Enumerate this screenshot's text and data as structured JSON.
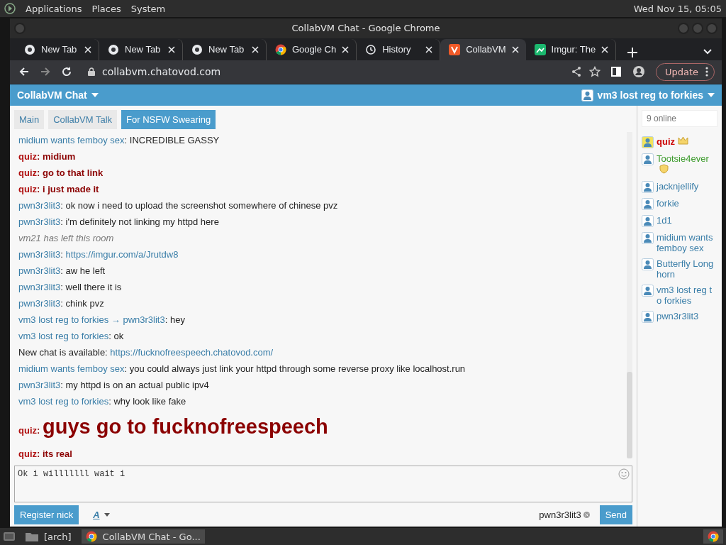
{
  "desktop_panel": {
    "menus": [
      "Applications",
      "Places",
      "System"
    ],
    "clock": "Wed Nov 15, 05:05"
  },
  "window": {
    "title": "CollabVM Chat - Google Chrome"
  },
  "browser_tabs": [
    {
      "title": "New Tab",
      "kind": "newtab",
      "selected": false
    },
    {
      "title": "New Tab",
      "kind": "newtab",
      "selected": false
    },
    {
      "title": "New Tab",
      "kind": "newtab",
      "selected": false
    },
    {
      "title": "Google Ch",
      "kind": "chrome",
      "selected": false
    },
    {
      "title": "History",
      "kind": "history",
      "selected": false
    },
    {
      "title": "CollabVM",
      "kind": "chatovod",
      "selected": true
    },
    {
      "title": "Imgur: The",
      "kind": "imgur",
      "selected": false
    }
  ],
  "address_bar": {
    "url": "collabvm.chatovod.com"
  },
  "update_button": "Update",
  "chat": {
    "title": "CollabVM Chat",
    "current_user": "vm3 lost reg to forkies",
    "rooms": [
      {
        "label": "Main",
        "selected": false
      },
      {
        "label": "CollabVM Talk",
        "selected": false
      },
      {
        "label": "For NSFW Swearing",
        "selected": true
      }
    ],
    "messages": [
      {
        "kind": "message",
        "author": "midium wants femboy sex",
        "owner": false,
        "sep": ":",
        "text": "INCREDIBLE GASSY"
      },
      {
        "kind": "message",
        "author": "quiz",
        "owner": true,
        "sep": ":",
        "text": "midium"
      },
      {
        "kind": "message",
        "author": "quiz",
        "owner": true,
        "sep": ":",
        "text": "go to that link"
      },
      {
        "kind": "message",
        "author": "quiz",
        "owner": true,
        "sep": ":",
        "text": "i just made it"
      },
      {
        "kind": "message",
        "author": "pwn3r3lit3",
        "owner": false,
        "sep": ":",
        "text": "ok now i need to upload the screenshot somewhere of chinese pvz"
      },
      {
        "kind": "message",
        "author": "pwn3r3lit3",
        "owner": false,
        "sep": ":",
        "text": "i'm definitely not linking my httpd here"
      },
      {
        "kind": "system",
        "text": "vm21 has left this room"
      },
      {
        "kind": "message",
        "author": "pwn3r3lit3",
        "owner": false,
        "sep": ":",
        "text": "https://imgur.com/a/Jrutdw8",
        "link": true
      },
      {
        "kind": "message",
        "author": "pwn3r3lit3",
        "owner": false,
        "sep": ":",
        "text": "aw he left"
      },
      {
        "kind": "message",
        "author": "pwn3r3lit3",
        "owner": false,
        "sep": ":",
        "text": "well there it is"
      },
      {
        "kind": "message",
        "author": "pwn3r3lit3",
        "owner": false,
        "sep": ":",
        "text": "chink pvz"
      },
      {
        "kind": "message",
        "author": "vm3 lost reg to forkies",
        "owner": false,
        "arrow": "→",
        "recipient": "pwn3r3lit3",
        "sep": ":",
        "text": "hey"
      },
      {
        "kind": "message",
        "author": "vm3 lost reg to forkies",
        "owner": false,
        "sep": ":",
        "text": "ok"
      },
      {
        "kind": "notice",
        "text": "New chat is available:",
        "url": "https://fucknofreespeech.chatovod.com/"
      },
      {
        "kind": "message",
        "author": "midium wants femboy sex",
        "owner": false,
        "sep": ":",
        "text": "you could always just link your httpd through some reverse proxy like localhost.run"
      },
      {
        "kind": "message",
        "author": "pwn3r3lit3",
        "owner": false,
        "sep": ":",
        "text": "my httpd is on an actual public ipv4"
      },
      {
        "kind": "message",
        "author": "vm3 lost reg to forkies",
        "owner": false,
        "sep": ":",
        "text": "why look like fake"
      },
      {
        "kind": "message",
        "author": "quiz",
        "owner": true,
        "sep": ":",
        "text": "guys go to fucknofreespeech",
        "large": true
      },
      {
        "kind": "message",
        "author": "quiz",
        "owner": true,
        "sep": ":",
        "text": "its real"
      }
    ],
    "online_count": "9 online",
    "users": [
      {
        "name": "quiz",
        "kind": "owner"
      },
      {
        "name": "Tootsie4ever",
        "kind": "moderator"
      },
      {
        "name": "jacknjellify",
        "kind": "user"
      },
      {
        "name": "forkie",
        "kind": "user"
      },
      {
        "name": "1d1",
        "kind": "user"
      },
      {
        "name": "midium wants femboy sex",
        "kind": "user"
      },
      {
        "name": "Butterfly Longhorn",
        "kind": "user"
      },
      {
        "name": "vm3 lost reg to forkies",
        "kind": "user"
      },
      {
        "name": "pwn3r3lit3",
        "kind": "user"
      }
    ],
    "input": {
      "value": "Ok i willlllll wait i"
    },
    "register_button": "Register nick",
    "format_button": "A",
    "nick": "pwn3r3lit3",
    "send_button": "Send"
  },
  "taskbar": {
    "items": [
      {
        "label": "[arch]",
        "kind": "folder",
        "selected": false
      },
      {
        "label": "CollabVM Chat - Go...",
        "kind": "chrome",
        "selected": true
      }
    ]
  }
}
